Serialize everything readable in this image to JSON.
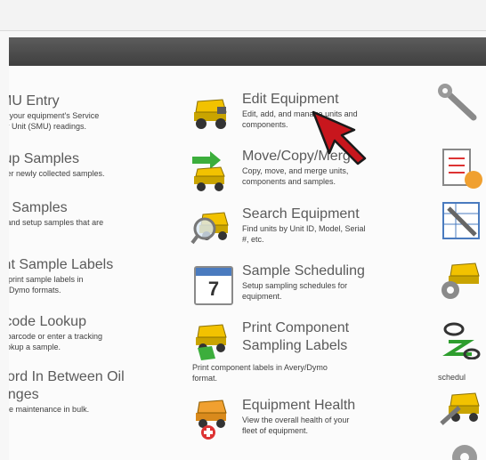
{
  "left_column": [
    {
      "title": "MU Entry",
      "desc1": "er your equipment's Service",
      "desc2": "ter Unit (SMU) readings."
    },
    {
      "title": "tup Samples",
      "desc1": "nter newly collected samples.",
      "desc2": ""
    },
    {
      "title": "e Samples",
      "desc1": "d and setup samples that are",
      "desc2": "."
    },
    {
      "title": "int Sample Labels",
      "desc1": "w/print sample labels in",
      "desc2": "ry/Dymo formats."
    },
    {
      "title": "rcode Lookup",
      "desc1": "a barcode or enter a tracking",
      "desc2": "lookup a sample."
    },
    {
      "title": "cord In Between Oil",
      "title2": "anges",
      "desc1": "nge maintenance in bulk.",
      "desc2": ""
    }
  ],
  "middle_column": [
    {
      "title": "Edit Equipment",
      "desc1": "Edit, add, and manage units and",
      "desc2": "components.",
      "icon": "truck-icon"
    },
    {
      "title": "Move/Copy/Merge",
      "desc1": "Copy, move, and merge units,",
      "desc2": "components and samples.",
      "icon": "truck-arrow-icon"
    },
    {
      "title": "Search Equipment",
      "desc1": "Find units by Unit ID, Model, Serial",
      "desc2": "#, etc.",
      "icon": "truck-magnifier-icon"
    },
    {
      "title": "Sample Scheduling",
      "desc1": "Setup sampling schedules for",
      "desc2": "equipment.",
      "icon": "calendar-icon",
      "calendar_day": "7"
    },
    {
      "title": "Print Component",
      "title2": "Sampling Labels",
      "desc1": "Print component labels in Avery/Dymo",
      "desc2": "format.",
      "icon": "truck-label-icon"
    },
    {
      "title": "Equipment Health",
      "desc1": "View the overall health of your",
      "desc2": "fleet of equipment.",
      "icon": "truck-health-icon"
    }
  ],
  "right_column": {
    "icons": [
      "wrench-icon",
      "checklist-icon",
      "spreadsheet-wrench-icon",
      "truck-gear-icon",
      "link-icon",
      "truck-wrench-icon",
      "gear-icon"
    ],
    "partial_label": "schedul"
  }
}
